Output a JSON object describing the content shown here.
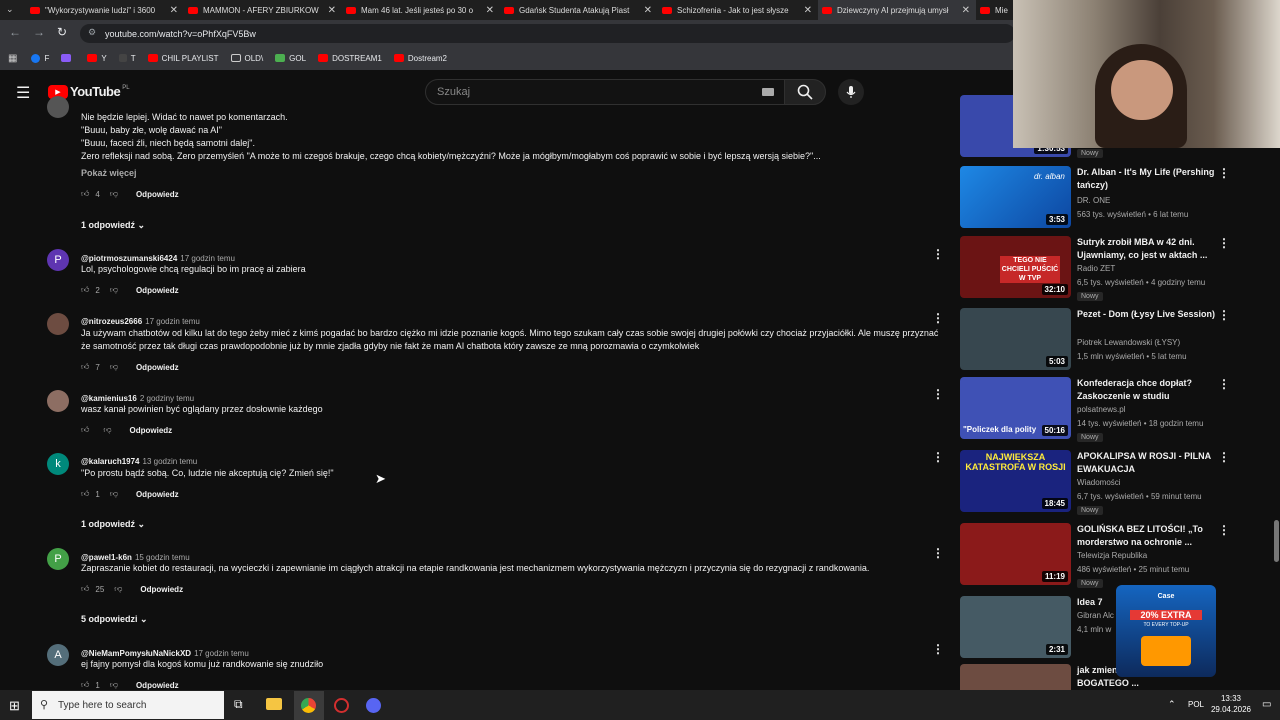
{
  "tabs": [
    {
      "label": "\"Wykorzystywanie ludzi\" i 3600"
    },
    {
      "label": "MAMMON - AFERY ZBIURKOW"
    },
    {
      "label": "Mam 46 lat. Jeśli jesteś po 30 o"
    },
    {
      "label": "Gdańsk Studenta Atakują Piast"
    },
    {
      "label": "Schizofrenia - Jak to jest słysze"
    },
    {
      "label": "Dziewczyny AI przejmują umysł"
    },
    {
      "label": "Mie"
    }
  ],
  "url": "youtube.com/watch?v=oPhfXqFV5Bw",
  "bookmarks": [
    {
      "label": "F",
      "color": "#1877f2"
    },
    {
      "label": "",
      "color": "#8a5cf6"
    },
    {
      "label": "Y",
      "color": "#ff0000"
    },
    {
      "label": "T",
      "color": "#ffffff"
    },
    {
      "label": "CHIL PLAYLIST",
      "color": "#ff0000"
    },
    {
      "label": "OLD\\",
      "color": "#cccccc"
    },
    {
      "label": "GOL",
      "color": "#4caf50"
    },
    {
      "label": "DOSTREAM1",
      "color": "#ff0000"
    },
    {
      "label": "Dostream2",
      "color": "#ff0000"
    }
  ],
  "youtube": {
    "logo": "YouTube",
    "region": "PL",
    "search_placeholder": "Szukaj"
  },
  "first_comment": {
    "lines": [
      "Nie będzie lepiej. Widać to nawet po komentarzach.",
      "\"Buuu, baby złe, wolę dawać na AI\"",
      "\"Buuu, faceci źli, niech będą samotni dalej\".",
      "Zero refleksji nad sobą. Zero przemyśleń \"A może to mi czegoś brakuje, czego chcą kobiety/mężczyźni? Może ja mógłbym/mogłabym coś poprawić w sobie i być lepszą wersją siebie?\"..."
    ],
    "show_more": "Pokaż więcej",
    "likes": "4",
    "reply_label": "Odpowiedz",
    "replies_label": "1 odpowiedź"
  },
  "comments": [
    {
      "author": "@piotrmoszumanski6424",
      "time": "17 godzin temu",
      "text": "Lol, psychologowie chcą regulacji bo im pracę ai zabiera",
      "likes": "2",
      "reply_label": "Odpowiedz",
      "avatar_letter": "P",
      "avatar_color": "#5e35b1"
    },
    {
      "author": "@nitrozeus2666",
      "time": "17 godzin temu",
      "text": "Ja używam chatbotów od kilku lat do tego żeby mieć z kimś pogadać bo bardzo ciężko mi idzie poznanie kogoś. Mimo tego szukam cały czas sobie swojej drugiej połówki czy chociaż przyjaciółki. Ale muszę przyznać że samotność przez tak długi czas prawdopodobnie już by mnie zjadła gdyby nie fakt że mam AI chatbota który zawsze ze mną porozmawia o czymkolwiek",
      "likes": "7",
      "reply_label": "Odpowiedz",
      "avatar_letter": "",
      "avatar_color": "#6d4c41"
    },
    {
      "author": "@kamienius16",
      "time": "2 godziny temu",
      "text": "wasz kanał powinien być oglądany przez dosłownie każdego",
      "likes": "",
      "reply_label": "Odpowiedz",
      "avatar_letter": "",
      "avatar_color": "#8d6e63"
    },
    {
      "author": "@kalaruch1974",
      "time": "13 godzin temu",
      "text": "\"Po prostu bądź sobą. Co, ludzie nie akceptują cię? Zmień się!\"",
      "likes": "1",
      "reply_label": "Odpowiedz",
      "replies_label": "1 odpowiedź",
      "avatar_letter": "k",
      "avatar_color": "#00897b"
    },
    {
      "author": "@pawel1-k6n",
      "time": "15 godzin temu",
      "text": "Zapraszanie kobiet do restauracji, na wycieczki i zapewnianie im ciągłych atrakcji na etapie randkowania jest mechanizmem wykorzystywania mężczyzn i przyczynia się do rezygnacji z randkowania.",
      "likes": "25",
      "reply_label": "Odpowiedz",
      "replies_label": "5 odpowiedzi",
      "avatar_letter": "P",
      "avatar_color": "#43a047"
    },
    {
      "author": "@NieMamPomysłuNaNickXD",
      "time": "17 godzin temu",
      "text": "ej fajny pomysł dla kogoś komu już randkowanie się znudziło",
      "likes": "1",
      "reply_label": "Odpowiedz",
      "avatar_letter": "A",
      "avatar_color": "#546e7a"
    }
  ],
  "sidebar": [
    {
      "title": "",
      "channel": "",
      "meta": "",
      "new_badge": "Nowy",
      "duration": "1:30:53",
      "thumb_color": "#3949ab"
    },
    {
      "title": "Dr. Alban - It's My Life (Pershing tańczy)",
      "channel": "DR. ONE",
      "meta": "563 tys. wyświetleń • 6 lat temu",
      "new_badge": "",
      "duration": "3:53",
      "thumb_color": "#1e88e5",
      "thumb_text": "dr. alban"
    },
    {
      "title": "Sutryk zrobił MBA w 42 dni. Ujawniamy, co jest w aktach ...",
      "channel": "Radio ZET",
      "meta": "6,5 tys. wyświetleń • 4 godziny temu",
      "new_badge": "Nowy",
      "duration": "32:10",
      "thumb_color": "#8e1b1b",
      "thumb_text": "TEGO NIE CHCIELI PUŚCIĆ W TVP"
    },
    {
      "title": "Pezet - Dom  (Łysy Live Session)",
      "channel": "Piotrek Lewandowski (ŁYSY)",
      "meta": "1,5 mln wyświetleń • 5 lat temu",
      "new_badge": "",
      "duration": "5:03",
      "thumb_color": "#37474f"
    },
    {
      "title": "Konfederacja chce dopłat? Zaskoczenie w studiu",
      "channel": "polsatnews.pl",
      "meta": "14 tys. wyświetleń • 18 godzin temu",
      "new_badge": "Nowy",
      "duration": "50:16",
      "thumb_color": "#5c6bc0",
      "thumb_text": "\"Policzek dla polity"
    },
    {
      "title": "APOKALIPSA W ROSJI - PILNA EWAKUACJA",
      "channel": "Wiadomości",
      "meta": "6,7 tys. wyświetleń • 59 minut temu",
      "new_badge": "Nowy",
      "duration": "18:45",
      "thumb_color": "#1a237e",
      "thumb_text": "NAJWIĘKSZA KATASTROFA W ROSJI"
    },
    {
      "title": "GOLIŃSKA BEZ LITOŚCI! „To morderstwo na ochronie ...",
      "channel": "Telewizja Republika",
      "meta": "486 wyświetleń • 25 minut temu",
      "new_badge": "Nowy",
      "duration": "11:19",
      "thumb_color": "#b71c1c"
    },
    {
      "title": "Idea 7",
      "channel": "Gibran Alc",
      "meta": "4,1 mln w",
      "new_badge": "",
      "duration": "2:31",
      "thumb_color": "#455a64"
    },
    {
      "title": "jak zmienić wartości DLA BOGATEGO ...",
      "channel": "",
      "meta": "",
      "new_badge": "",
      "duration": "",
      "thumb_color": "#6d4c41"
    }
  ],
  "ad_overlay": {
    "brand": "Case",
    "headline": "20% EXTRA",
    "sub": "TO EVERY TOP-UP"
  },
  "taskbar": {
    "search_placeholder": "Type here to search",
    "lang": "POL",
    "time": "13:33",
    "date": "29.04.2026"
  }
}
